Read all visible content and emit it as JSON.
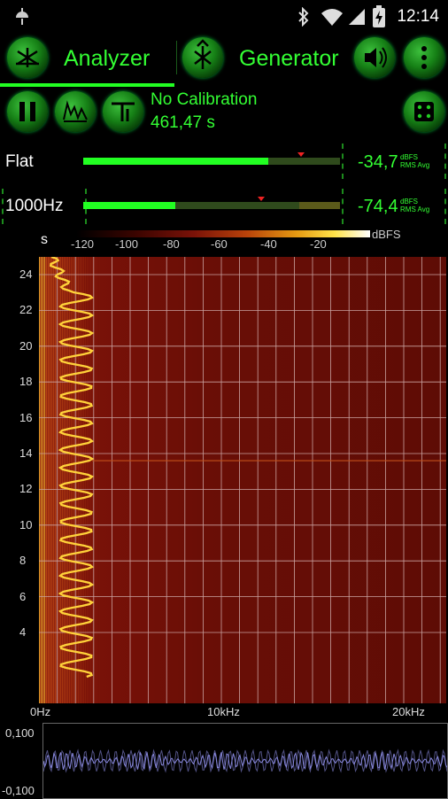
{
  "status": {
    "time": "12:14"
  },
  "tabs": {
    "analyzer": "Analyzer",
    "generator": "Generator"
  },
  "info": {
    "calibration": "No Calibration",
    "elapsed": "461,47 s"
  },
  "meters": [
    {
      "label": "Flat",
      "value": "-34,7",
      "unit_top": "dBFS",
      "unit_bottom": "RMS Avg",
      "level": 0.72
    },
    {
      "label": "1000Hz",
      "value": "-74,4",
      "unit_top": "dBFS",
      "unit_bottom": "RMS Avg",
      "level": 0.36
    }
  ],
  "colorbar": {
    "unit_left": "s",
    "unit_right": "dBFS",
    "ticks": [
      "-120",
      "-100",
      "-80",
      "-60",
      "-40",
      "-20"
    ]
  },
  "spectrogram": {
    "y_ticks": [
      "24",
      "22",
      "20",
      "18",
      "16",
      "14",
      "12",
      "10",
      "8",
      "6",
      "4"
    ],
    "x_ticks": [
      "0Hz",
      "10kHz",
      "20kHz"
    ]
  },
  "waveform": {
    "y_top": "0,100",
    "y_bottom": "-0,100"
  },
  "colors": {
    "accent": "#33ff33",
    "spectrogram_bg": "#7a1208",
    "trace": "#ffd23a",
    "wave": "#8888dd"
  }
}
